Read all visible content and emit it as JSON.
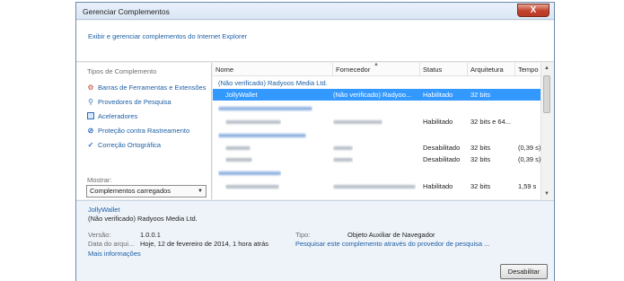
{
  "window": {
    "title": "Gerenciar Complementos",
    "close_glyph": "X"
  },
  "header": {
    "text": "Exibir e gerenciar complementos do Internet Explorer"
  },
  "sidebar": {
    "title": "Tipos de Complemento",
    "items": [
      {
        "label": "Barras de Ferramentas e Extensões",
        "icon": "gear-icon"
      },
      {
        "label": "Provedores de Pesquisa",
        "icon": "search-icon"
      },
      {
        "label": "Aceleradores",
        "icon": "accelerator-icon"
      },
      {
        "label": "Proteção contra Rastreamento",
        "icon": "block-icon"
      },
      {
        "label": "Correção Ortográfica",
        "icon": "spell-icon"
      }
    ],
    "show_label": "Mostrar:",
    "show_value": "Complementos carregados"
  },
  "table": {
    "columns": [
      "Nome",
      "Fornecedor",
      "Status",
      "Arquitetura",
      "Tempo"
    ],
    "group_title": "(Não verificado) Radyoos Media Ltd.",
    "rows": [
      {
        "name": "JollyWallet",
        "vendor": "(Não verificado) Radyoo...",
        "status": "Habilitado",
        "arch": "32 bits",
        "time": ""
      },
      {
        "name": "",
        "vendor": "",
        "status": "Habilitado",
        "arch": "32 bits e 64...",
        "time": ""
      },
      {
        "name": "",
        "vendor": "",
        "status": "Desabilitado",
        "arch": "32 bits",
        "time": "(0,39 s)"
      },
      {
        "name": "",
        "vendor": "",
        "status": "Desabilitado",
        "arch": "32 bits",
        "time": "(0,39 s)"
      },
      {
        "name": "",
        "vendor": "",
        "status": "Habilitado",
        "arch": "32 bits",
        "time": "1,59 s"
      }
    ]
  },
  "details": {
    "name": "JollyWallet",
    "publisher": "(Não verificado) Radyoos Media Ltd.",
    "version_label": "Versão:",
    "version": "1.0.0.1",
    "date_label": "Data do arqui...",
    "date": "Hoje, 12 de fevereiro de 2014, 1 hora atrás",
    "more_info": "Mais informações",
    "type_label": "Tipo:",
    "type": "Objeto Auxiliar de Navegador",
    "search_link": "Pesquisar este complemento através do provedor de pesquisa ...",
    "disable_button": "Desabilitar"
  }
}
